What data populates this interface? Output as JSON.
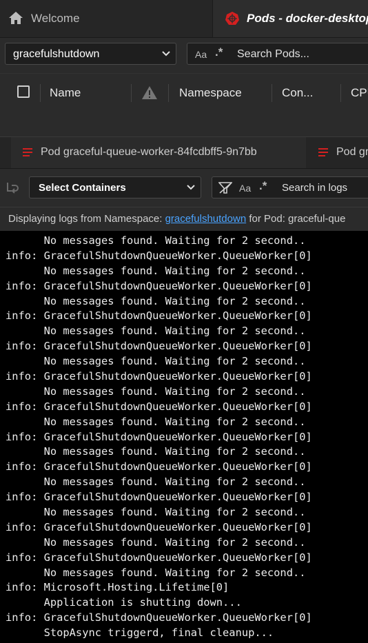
{
  "tabs": [
    {
      "label": "Welcome",
      "icon": "home-icon"
    },
    {
      "label": "Pods - docker-desktop",
      "icon": "kubernetes-icon",
      "accent": "#e02020"
    }
  ],
  "namespace_select": {
    "value": "gracefulshutdown"
  },
  "pod_search": {
    "placeholder": "Search Pods...",
    "case_label": "Aa",
    "regex_label": ".*"
  },
  "table": {
    "columns": [
      "Name",
      "Namespace",
      "Con...",
      "CPU"
    ],
    "warning_icon": "warning-icon"
  },
  "log_tabs": [
    {
      "label": "Pod graceful-queue-worker-84fcdbff5-9n7bb",
      "icon": "log-icon"
    },
    {
      "label": "Pod gr",
      "icon": "log-icon"
    }
  ],
  "log_toolbar": {
    "containers_select": "Select Containers",
    "search_placeholder": "Search in logs",
    "case_label": "Aa",
    "regex_label": ".*"
  },
  "info_bar": {
    "prefix": "Displaying logs from Namespace: ",
    "namespace_link": "gracefulshutdown",
    "suffix": " for Pod: graceful-que"
  },
  "logs": [
    "      No messages found. Waiting for 2 second..",
    "info: GracefulShutdownQueueWorker.QueueWorker[0]",
    "      No messages found. Waiting for 2 second..",
    "info: GracefulShutdownQueueWorker.QueueWorker[0]",
    "      No messages found. Waiting for 2 second..",
    "info: GracefulShutdownQueueWorker.QueueWorker[0]",
    "      No messages found. Waiting for 2 second..",
    "info: GracefulShutdownQueueWorker.QueueWorker[0]",
    "      No messages found. Waiting for 2 second..",
    "info: GracefulShutdownQueueWorker.QueueWorker[0]",
    "      No messages found. Waiting for 2 second..",
    "info: GracefulShutdownQueueWorker.QueueWorker[0]",
    "      No messages found. Waiting for 2 second..",
    "info: GracefulShutdownQueueWorker.QueueWorker[0]",
    "      No messages found. Waiting for 2 second..",
    "info: GracefulShutdownQueueWorker.QueueWorker[0]",
    "      No messages found. Waiting for 2 second..",
    "info: GracefulShutdownQueueWorker.QueueWorker[0]",
    "      No messages found. Waiting for 2 second..",
    "info: GracefulShutdownQueueWorker.QueueWorker[0]",
    "      No messages found. Waiting for 2 second..",
    "info: GracefulShutdownQueueWorker.QueueWorker[0]",
    "      No messages found. Waiting for 2 second..",
    "info: Microsoft.Hosting.Lifetime[0]",
    "      Application is shutting down...",
    "info: GracefulShutdownQueueWorker.QueueWorker[0]",
    "      StopAsync triggerd, final cleanup..."
  ]
}
